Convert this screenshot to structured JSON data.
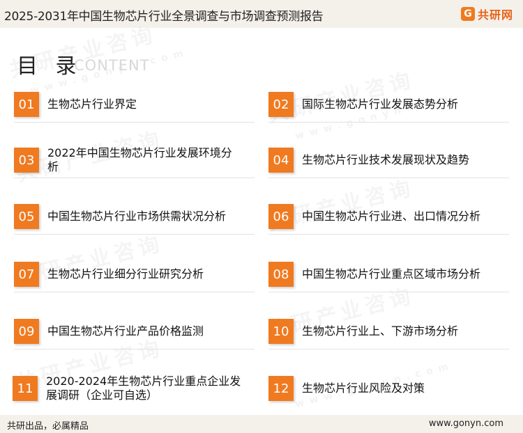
{
  "header": {
    "title": "2025-2031年中国生物芯片行业全景调查与市场调查预测报告"
  },
  "logo": {
    "mark": "G",
    "text": "共研网"
  },
  "watermark": {
    "text": "共研产业咨询",
    "sub": "www.gonyn.com"
  },
  "toc": {
    "title": "目 录",
    "title_en": "CONTENT",
    "items": [
      {
        "num": "01",
        "label": "生物芯片行业界定"
      },
      {
        "num": "02",
        "label": "国际生物芯片行业发展态势分析"
      },
      {
        "num": "03",
        "label": "2022年中国生物芯片行业发展环境分析"
      },
      {
        "num": "04",
        "label": "生物芯片行业技术发展现状及趋势"
      },
      {
        "num": "05",
        "label": "中国生物芯片行业市场供需状况分析"
      },
      {
        "num": "06",
        "label": "中国生物芯片行业进、出口情况分析"
      },
      {
        "num": "07",
        "label": "生物芯片行业细分行业研究分析"
      },
      {
        "num": "08",
        "label": "中国生物芯片行业重点区域市场分析"
      },
      {
        "num": "09",
        "label": "中国生物芯片行业产品价格监测"
      },
      {
        "num": "10",
        "label": "生物芯片行业上、下游市场分析"
      },
      {
        "num": "11",
        "label": "2020-2024年生物芯片行业重点企业发展调研（企业可自选）"
      },
      {
        "num": "12",
        "label": "生物芯片行业风险及对策"
      }
    ]
  },
  "footer": {
    "left": "共研出品，必属精品",
    "right": "www.gonyn.com"
  },
  "colors": {
    "accent": "#f07a20",
    "band": "#f4f0ea"
  }
}
